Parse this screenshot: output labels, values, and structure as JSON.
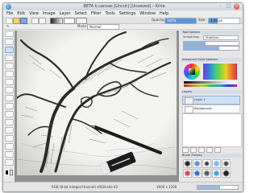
{
  "window": {
    "title": "BETA k.canvas [Uncut] [Unsaved] – Krita"
  },
  "menu": [
    "File",
    "Edit",
    "View",
    "Image",
    "Layer",
    "Select",
    "Filter",
    "Tools",
    "Settings",
    "Window",
    "Help"
  ],
  "toolbar": {
    "opacity_label": "Opacity:",
    "opacity_value": "100%",
    "opacity_fraction": 1.0,
    "size_label": "Size:",
    "size_value": "4.00 px",
    "size_fraction": 0.3
  },
  "options": {
    "mode_label": "Mode:",
    "mode_value": "Normal"
  },
  "dockers": {
    "tool_options": {
      "title": "Tool Options",
      "items": [
        "Smoothing:",
        "Stabilizer"
      ]
    },
    "advanced_color": {
      "title": "Advanced Color Selector"
    },
    "layers": {
      "title": "Layers",
      "rows": [
        {
          "name": "Layer 1"
        },
        {
          "name": "Background"
        }
      ]
    },
    "presets": {
      "title": "Brush Presets"
    }
  },
  "status": {
    "left": "RGB (8-bit integer/channel) sRGB-elle-V2",
    "right": "1600 x 1200"
  }
}
